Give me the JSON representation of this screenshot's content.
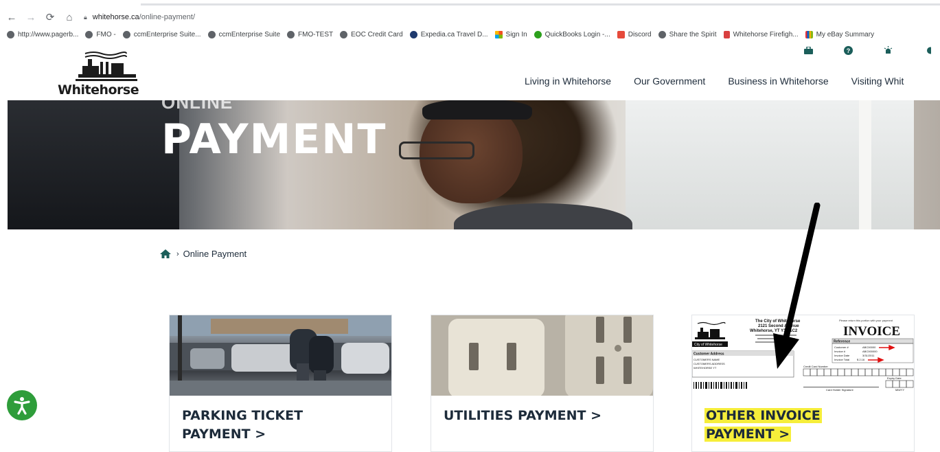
{
  "browser": {
    "url_host": "whitehorse.ca",
    "url_path": "/online-payment/",
    "bookmarks": [
      {
        "label": "http://www.pagerb...",
        "icon": "globe-icon"
      },
      {
        "label": "FMO -",
        "icon": "globe-icon"
      },
      {
        "label": "ccmEnterprise Suite...",
        "icon": "globe-icon"
      },
      {
        "label": "ccmEnterprise Suite",
        "icon": "globe-icon"
      },
      {
        "label": "FMO-TEST",
        "icon": "globe-icon"
      },
      {
        "label": "EOC Credit Card",
        "icon": "globe-icon"
      },
      {
        "label": "Expedia.ca Travel D...",
        "icon": "expedia-icon"
      },
      {
        "label": "Sign In",
        "icon": "microsoft-icon"
      },
      {
        "label": "QuickBooks Login -...",
        "icon": "quickbooks-icon"
      },
      {
        "label": "Discord",
        "icon": "discord-icon"
      },
      {
        "label": "Share the Spirit",
        "icon": "globe-icon"
      },
      {
        "label": "Whitehorse Firefigh...",
        "icon": "firefighter-icon"
      },
      {
        "label": "My eBay Summary",
        "icon": "ebay-icon"
      }
    ]
  },
  "site": {
    "logo_text": "Whitehorse",
    "nav": [
      "Living in Whitehorse",
      "Our Government",
      "Business in Whitehorse",
      "Visiting Whit"
    ]
  },
  "hero": {
    "small": "ONLINE",
    "title": "PAYMENT"
  },
  "breadcrumb": {
    "current": "Online Payment"
  },
  "cards": [
    {
      "line1": "PARKING TICKET",
      "line2": "PAYMENT >"
    },
    {
      "line1": "UTILITIES PAYMENT >",
      "line2": ""
    },
    {
      "line1": "OTHER INVOICE",
      "line2": "PAYMENT >"
    }
  ],
  "invoice_thumb": {
    "heading": "INVOICE",
    "org_line1": "The City of Whitehorse",
    "org_line2": "2121 Second Avenue",
    "org_line3": "Whitehorse, YT Y1A 1C2",
    "city_label": "City of Whitehorse",
    "return_note": "Please return this portion with your payment",
    "reference": "Reference",
    "customer_address": "Customer Address",
    "customer_lines": [
      "CUSTOMERS NAME",
      "CUSTOMERS ADDRESS",
      "WHITEHORSE YT"
    ],
    "fields": [
      {
        "label": "Customer #",
        "value": "ABC00000"
      },
      {
        "label": "Invoice #",
        "value": "ABC000000"
      },
      {
        "label": "Invoice Date",
        "value": "3/31/2011"
      },
      {
        "label": "Invoice Total",
        "value": "$ 2.16"
      }
    ],
    "card_number": "Credit Card Number",
    "expiry": "Expiry Date",
    "signature": "Card Holder Signature",
    "mmyy": "MM/YY"
  },
  "colors": {
    "accent": "#1b5e5a",
    "highlight": "#f6ee3a",
    "accessibility": "#2e9d3a",
    "arrow": "#000000"
  }
}
